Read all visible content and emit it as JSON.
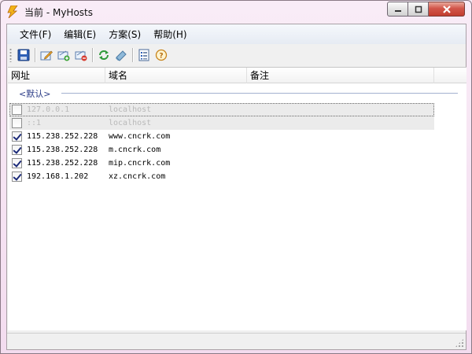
{
  "window": {
    "title": "当前 - MyHosts"
  },
  "menu": [
    {
      "label": "文件(F)"
    },
    {
      "label": "编辑(E)"
    },
    {
      "label": "方案(S)"
    },
    {
      "label": "帮助(H)"
    }
  ],
  "toolbar": {
    "icons": [
      "save-icon",
      "edit-icon",
      "add-entry-icon",
      "remove-entry-icon",
      "refresh-icon",
      "flush-icon",
      "properties-icon",
      "help-icon"
    ]
  },
  "columns": {
    "address": "网址",
    "domain": "域名",
    "note": "备注"
  },
  "group": {
    "label": "<默认>"
  },
  "rows": [
    {
      "checked": false,
      "enabled": false,
      "address": "127.0.0.1",
      "domain": "localhost"
    },
    {
      "checked": false,
      "enabled": false,
      "address": "::1",
      "domain": "localhost"
    },
    {
      "checked": true,
      "enabled": true,
      "address": "115.238.252.228",
      "domain": "www.cncrk.com"
    },
    {
      "checked": true,
      "enabled": true,
      "address": "115.238.252.228",
      "domain": "m.cncrk.com"
    },
    {
      "checked": true,
      "enabled": true,
      "address": "115.238.252.228",
      "domain": "mip.cncrk.com"
    },
    {
      "checked": true,
      "enabled": true,
      "address": "192.168.1.202",
      "domain": "xz.cncrk.com"
    }
  ],
  "colors": {
    "title_gradient_top": "#f9ecf7",
    "group_label": "#2a3b86",
    "checkmark": "#1c2b79"
  }
}
